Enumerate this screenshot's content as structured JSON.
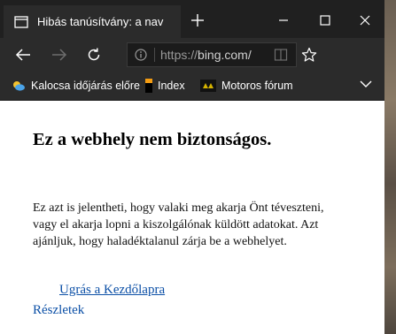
{
  "browser": {
    "tab": {
      "title": "Hibás tanúsítvány: a nav"
    },
    "address": {
      "scheme": "https://",
      "host": "bing.com/"
    }
  },
  "favorites": [
    {
      "label": "Kalocsa időjárás előre",
      "icon": "weather-icon"
    },
    {
      "label": "Index",
      "icon": "index-logo-icon"
    },
    {
      "label": "Motoros fórum",
      "icon": "motor-forum-icon"
    }
  ],
  "page": {
    "heading": "Ez a webhely nem biztonságos.",
    "body_lines": [
      "Ez azt is jelentheti, hogy valaki meg akarja Önt téveszteni,",
      "vagy el akarja lopni a kiszolgálónak küldött adatokat. Azt",
      "ajánljuk, hogy haladéktalanul zárja be a webhelyet."
    ],
    "home_link": "Ugrás a Kezdőlapra",
    "details_link": "Részletek"
  },
  "colors": {
    "chrome_dark": "#202020",
    "chrome_mid": "#2b2b2b",
    "link": "#0b4fa6"
  }
}
